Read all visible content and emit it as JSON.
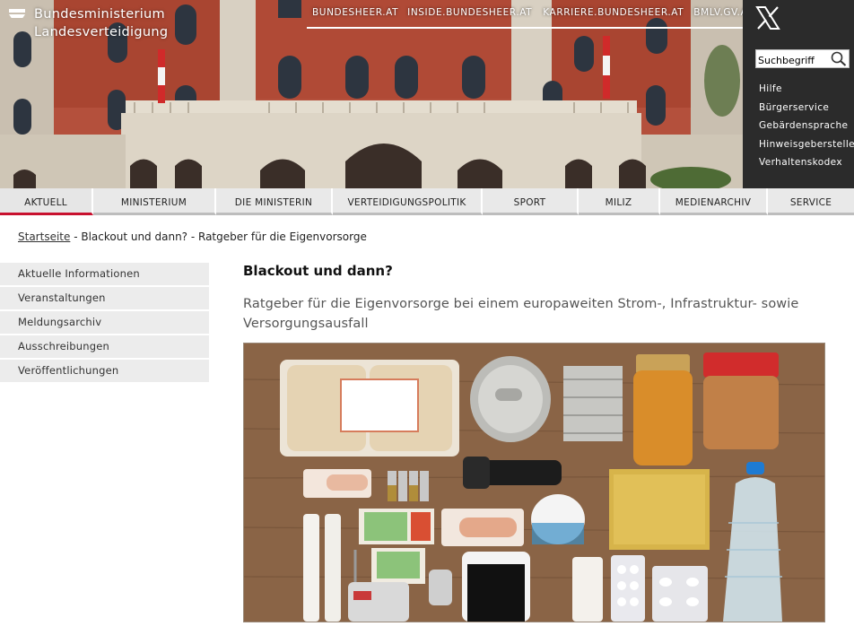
{
  "header": {
    "logo_line1": "Bundesministerium",
    "logo_line2": "Landesverteidigung",
    "top_links": [
      "BUNDESHEER.AT",
      "INSIDE.BUNDESHEER.AT",
      "KARRIERE.BUNDESHEER.AT",
      "BMLV.GV.AT"
    ],
    "social_icon": "x-icon",
    "search_placeholder": "Suchbegriff",
    "service_links": [
      "Hilfe",
      "Bürgerservice",
      "Gebärdensprache",
      "Hinweisgeberstelle",
      "Verhaltenskodex"
    ]
  },
  "nav": {
    "items": [
      "AKTUELL",
      "MINISTERIUM",
      "DIE MINISTERIN",
      "VERTEIDIGUNGSPOLITIK",
      "SPORT",
      "MILIZ",
      "MEDIENARCHIV",
      "SERVICE"
    ],
    "active_index": 0
  },
  "breadcrumb": {
    "home": "Startseite",
    "separator": " - ",
    "current": "Blackout und dann? - Ratgeber für die Eigenvorsorge"
  },
  "sidebar": {
    "items": [
      "Aktuelle Informationen",
      "Veranstaltungen",
      "Meldungsarchiv",
      "Ausschreibungen",
      "Veröffentlichungen"
    ]
  },
  "article": {
    "title": "Blackout und dann?",
    "lead": "Ratgeber für die Eigenvorsorge bei einem europaweiten Strom-, Infrastruktur- sowie Versorgungsausfall"
  },
  "colors": {
    "accent_red": "#c8102e",
    "panel_dark": "#2b2b2b",
    "nav_bg": "#e9e9e9"
  }
}
